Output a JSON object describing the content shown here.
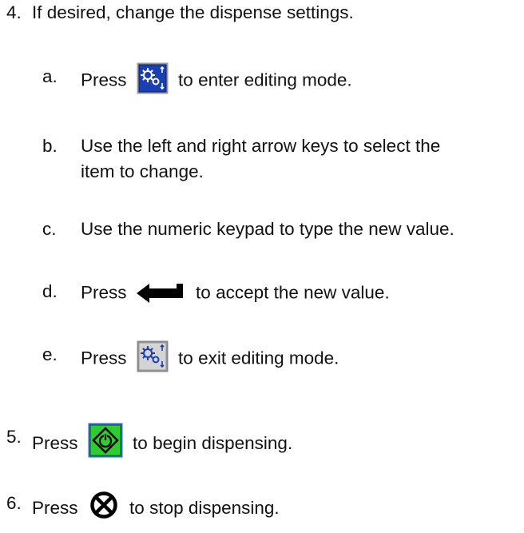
{
  "steps": [
    {
      "num": "4.",
      "text": "If desired, change the dispense settings."
    },
    {
      "num": "5.",
      "before": "Press",
      "after": "to begin dispensing.",
      "icon": "start-dispense-icon",
      "icon_color": "#2ecc2e"
    },
    {
      "num": "6.",
      "before": "Press",
      "after": "to stop dispensing.",
      "icon": "stop-dispense-icon"
    }
  ],
  "substeps": [
    {
      "letter": "a.",
      "before": "Press",
      "after": "to enter editing mode.",
      "icon": "settings-edit-icon",
      "icon_bg": "#1a3fb0"
    },
    {
      "letter": "b.",
      "line1": "Use the left and right arrow keys to select the",
      "line2": "item to change."
    },
    {
      "letter": "c.",
      "text": "Use the numeric keypad to type the new value."
    },
    {
      "letter": "d.",
      "before": "Press",
      "after": "to accept the new value.",
      "icon": "enter-icon"
    },
    {
      "letter": "e.",
      "before": "Press",
      "after": "to exit editing mode.",
      "icon": "settings-exit-icon",
      "icon_bg": "#d4d4d4"
    }
  ]
}
